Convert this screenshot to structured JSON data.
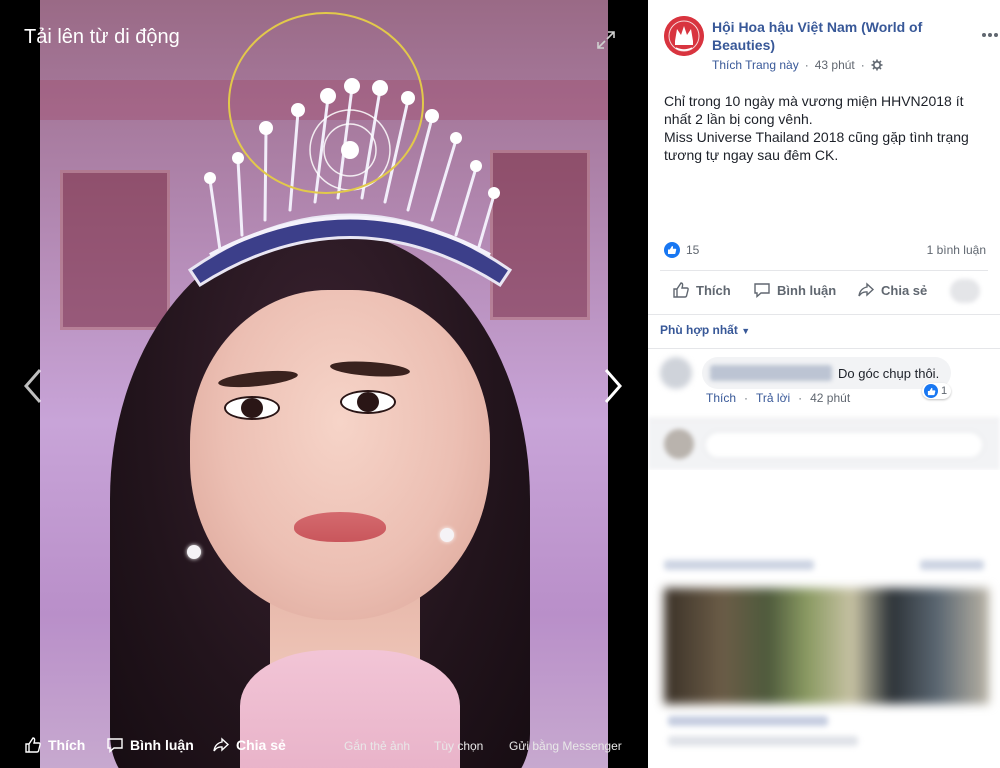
{
  "viewer": {
    "upload_label": "Tải lên từ di động",
    "actions": {
      "like": "Thích",
      "comment": "Bình luận",
      "share": "Chia sẻ",
      "tag": "Gắn thẻ ảnh",
      "options": "Tùy chọn",
      "messenger": "Gửi bằng Messenger"
    },
    "icons": [
      "expand-icon",
      "chevron-left-icon",
      "chevron-right-icon",
      "thumbs-up-icon",
      "comment-icon",
      "share-icon"
    ],
    "annotation_color": "#e2c94a"
  },
  "post": {
    "page_name": "Hội Hoa hậu Việt Nam (World of Beauties)",
    "like_page": "Thích Trang này",
    "separator": "·",
    "time": "43 phút",
    "privacy_icon": "gear-icon",
    "text_lines": [
      "Chỉ trong 10 ngày mà vương miện HHVN2018 ít nhất 2 lần bị cong vênh.",
      "Miss Universe Thailand 2018 cũng gặp tình trạng tương tự ngay sau đêm CK."
    ],
    "like_count": "15",
    "comment_count": "1 bình luận",
    "actions": {
      "like": "Thích",
      "comment": "Bình luận",
      "share": "Chia sẻ"
    }
  },
  "comments": {
    "sort_label": "Phù hợp nhất",
    "items": [
      {
        "text": "Do góc chụp thôi.",
        "likes": "1",
        "like_action": "Thích",
        "reply_action": "Trả lời",
        "time": "42 phút"
      }
    ]
  },
  "colors": {
    "link": "#385898",
    "like_blue": "#1877f2",
    "panel_bg": "#ffffff",
    "viewer_bg": "#000000"
  }
}
